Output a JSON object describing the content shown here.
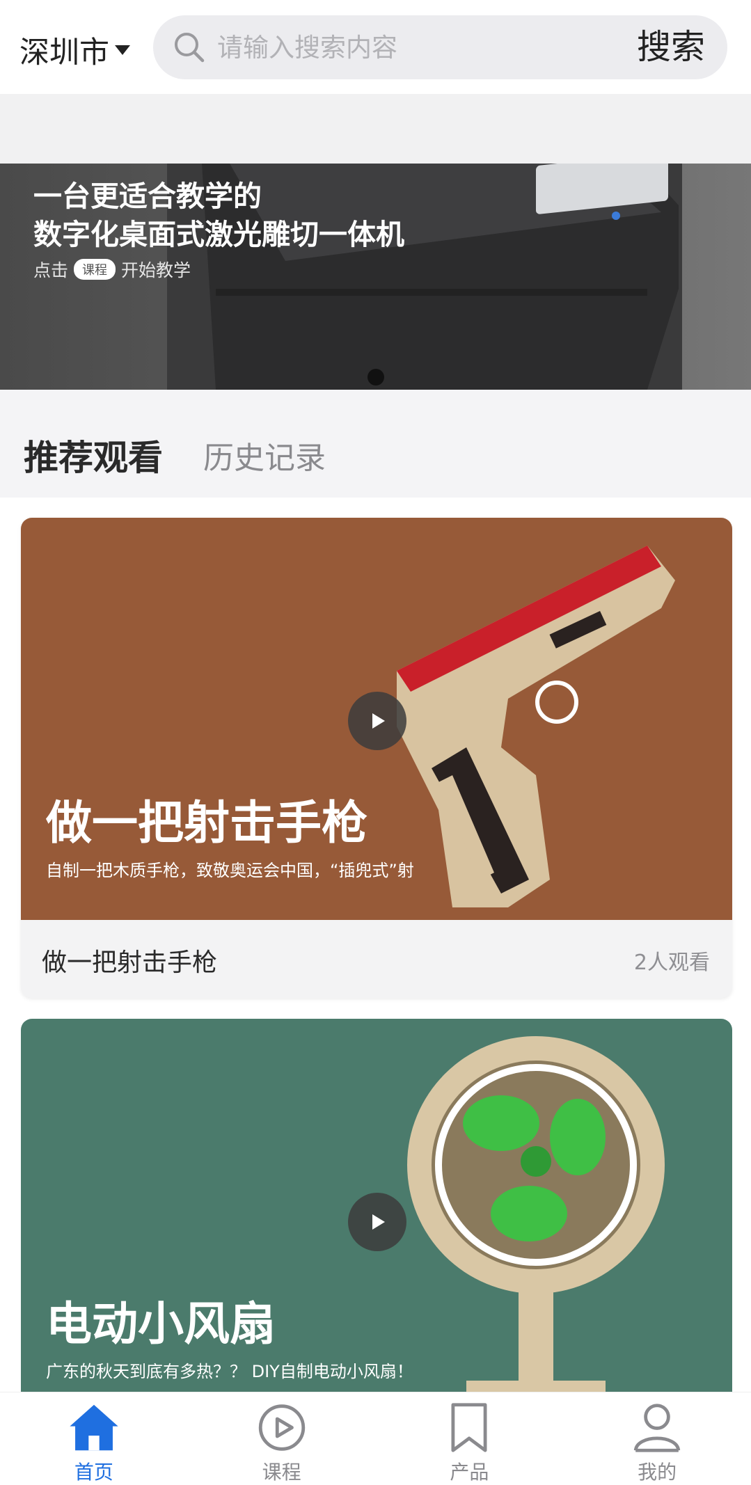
{
  "header": {
    "city": "深圳市",
    "search_placeholder": "请输入搜索内容",
    "search_button": "搜索"
  },
  "banner": {
    "title_line1": "一台更适合教学的",
    "title_line2": "数字化桌面式激光雕切一体机",
    "sub_prefix": "点击",
    "sub_badge": "课程",
    "sub_suffix": "开始教学"
  },
  "tabs": {
    "recommended": "推荐观看",
    "history": "历史记录"
  },
  "cards": [
    {
      "overlay_title": "做一把射击手枪",
      "overlay_desc": "自制一把木质手枪，致敬奥运会中国，“插兜式”射",
      "name": "做一把射击手枪",
      "views": "2人观看",
      "bg_color": "#975a38"
    },
    {
      "overlay_title": "电动小风扇",
      "overlay_desc": "广东的秋天到底有多热？？ DIY自制电动小风扇！",
      "bg_color": "#4b7b6c"
    }
  ],
  "bottom_nav": [
    {
      "label": "首页",
      "icon": "home-icon",
      "active": true
    },
    {
      "label": "课程",
      "icon": "play-circle-icon",
      "active": false
    },
    {
      "label": "产品",
      "icon": "bookmark-icon",
      "active": false
    },
    {
      "label": "我的",
      "icon": "user-icon",
      "active": false
    }
  ],
  "colors": {
    "accent": "#1f6fe0",
    "inactive": "#8a8a8e"
  }
}
